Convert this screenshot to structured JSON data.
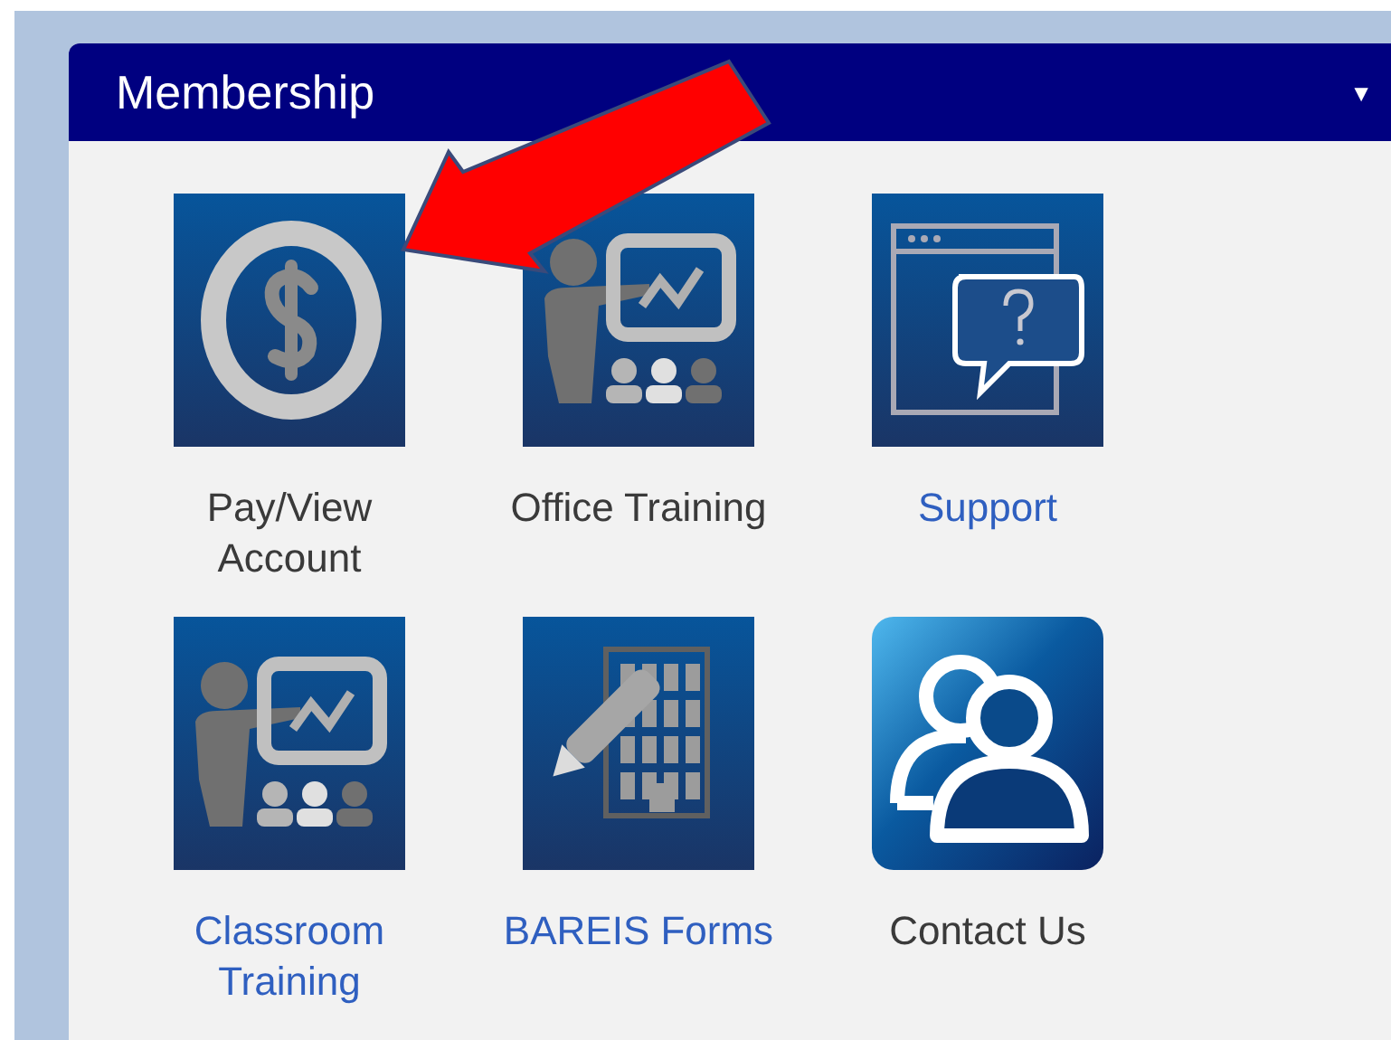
{
  "panel": {
    "title": "Membership",
    "collapse_glyph": "▼"
  },
  "tiles": [
    {
      "kind": "dollar",
      "label": "Pay/View Account",
      "link": false
    },
    {
      "kind": "presenter",
      "label": "Office Training",
      "link": false
    },
    {
      "kind": "support",
      "label": "Support",
      "link": true
    },
    {
      "kind": "presenter",
      "label": "Classroom Training",
      "link": true
    },
    {
      "kind": "forms",
      "label": "BAREIS Forms",
      "link": true
    },
    {
      "kind": "contacts",
      "label": "Contact Us",
      "link": false
    }
  ]
}
